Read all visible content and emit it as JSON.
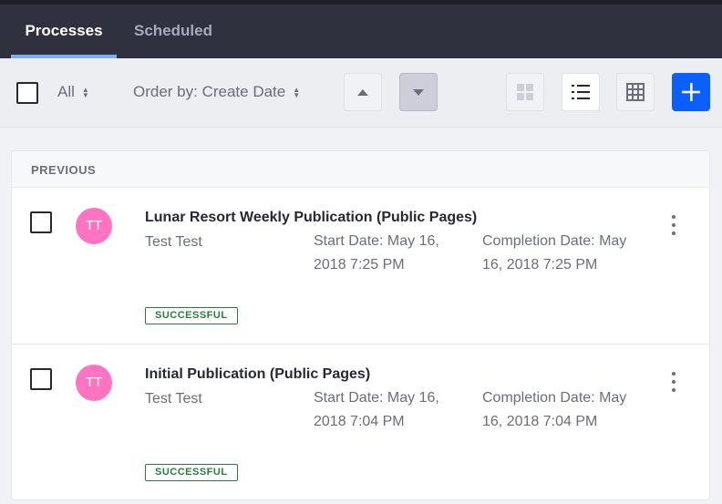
{
  "tabs": [
    {
      "label": "Processes",
      "active": true
    },
    {
      "label": "Scheduled",
      "active": false
    }
  ],
  "toolbar": {
    "filter_label": "All",
    "order_label": "Order by: Create Date",
    "sort_ascending_icon": "caret-up-icon",
    "sort_descending_icon": "caret-down-icon",
    "view_icons": [
      "cards-icon",
      "list-icon",
      "table-icon"
    ],
    "add_icon": "plus-icon"
  },
  "section_label": "PREVIOUS",
  "processes": [
    {
      "initials": "TT",
      "title": "Lunar Resort Weekly Publication (Public Pages)",
      "user": "Test Test",
      "start": "Start Date: May 16, 2018 7:25 PM",
      "completion": "Completion Date: May 16, 2018 7:25 PM",
      "status": "SUCCESSFUL"
    },
    {
      "initials": "TT",
      "title": "Initial Publication (Public Pages)",
      "user": "Test Test",
      "start": "Start Date: May 16, 2018 7:04 PM",
      "completion": "Completion Date: May 16, 2018 7:04 PM",
      "status": "SUCCESSFUL"
    }
  ],
  "colors": {
    "topbar": "#30313f",
    "tab_indicator": "#80acff",
    "primary": "#0b5fff",
    "avatar": "#ff73c3",
    "success": "#287d3c"
  }
}
